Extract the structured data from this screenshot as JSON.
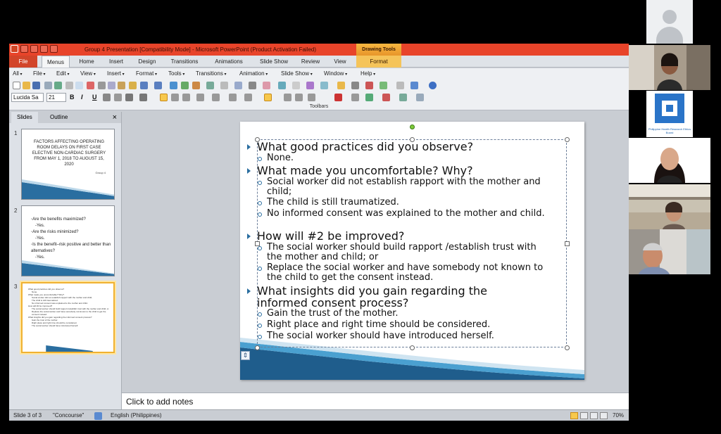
{
  "window": {
    "title": "Group 4 Presentation [Compatibility Mode] - Microsoft PowerPoint (Product Activation Failed)",
    "contextual_tab": "Drawing Tools"
  },
  "ribbon_tabs": [
    "File",
    "Menus",
    "Home",
    "Insert",
    "Design",
    "Transitions",
    "Animations",
    "Slide Show",
    "Review",
    "View",
    "Format"
  ],
  "menus": [
    "All",
    "File",
    "Edit",
    "View",
    "Insert",
    "Format",
    "Tools",
    "Transitions",
    "Animation",
    "Slide Show",
    "Window",
    "Help"
  ],
  "toolbar": {
    "font_name": "Lucida Sa",
    "font_size": "21",
    "bold": "B",
    "italic": "I",
    "underline": "U",
    "footer_label": "Toolbars"
  },
  "pane": {
    "tabs": [
      "Slides",
      "Outline"
    ],
    "close": "×"
  },
  "thumbnails": {
    "slide1": {
      "number": "1",
      "title": "FACTORS AFFECTING OPERATING ROOM DELAYS ON FIRST CASE ELECTIVE NON-CARDIAC SURGERY FROM MAY 1, 2018 TO AUGUST 15, 2020",
      "subtitle": "Group 4"
    },
    "slide2": {
      "number": "2",
      "lines": [
        "◦Are the benefits maximized?",
        "  -Yes.",
        "◦Are the risks minimized?",
        "  -Yes.",
        "◦Is the benefit–risk positive and better than alternatives?",
        "  -Yes."
      ]
    },
    "slide3": {
      "number": "3"
    }
  },
  "slide": {
    "items": [
      {
        "level": 1,
        "text": "What good practices did you observe?"
      },
      {
        "level": 2,
        "text": "None."
      },
      {
        "level": 1,
        "text": "What made you uncomfortable? Why?"
      },
      {
        "level": 2,
        "text": "Social worker did not establish rapport with the mother and child;"
      },
      {
        "level": 2,
        "text": "The child is still traumatized."
      },
      {
        "level": 2,
        "text": "No informed consent was explained to the mother and child."
      },
      {
        "level": 1,
        "text": "How will #2 be improved?"
      },
      {
        "level": 2,
        "text": "The social worker should build rapport /establish trust with the mother and child; or"
      },
      {
        "level": 2,
        "text": "Replace the social worker and have somebody not known to the child to get the consent instead."
      },
      {
        "level": 1,
        "text": "What insights did you gain regarding the informed consent process?"
      },
      {
        "level": 2,
        "text": "Gain the trust of the mother."
      },
      {
        "level": 2,
        "text": "Right place and right time should be considered."
      },
      {
        "level": 2,
        "text": "The social worker should have introduced herself."
      }
    ]
  },
  "notes_placeholder": "Click to add notes",
  "status": {
    "slide_indicator": "Slide 3 of 3",
    "theme": "\"Concourse\"",
    "language": "English (Philippines)",
    "zoom": "70%"
  },
  "video": {
    "logo_caption": "Philippine Health Research Ethics Board"
  }
}
